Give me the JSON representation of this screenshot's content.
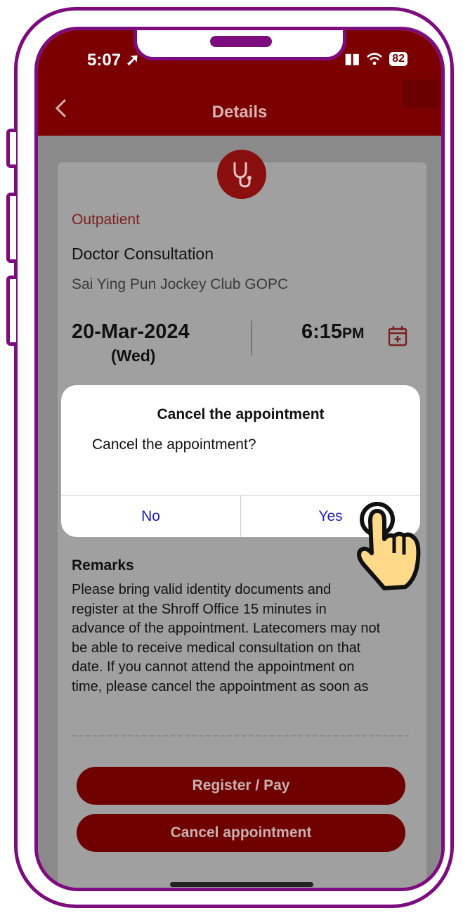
{
  "status": {
    "time": "5:07",
    "battery": "82"
  },
  "nav": {
    "title": "Details"
  },
  "appointment": {
    "type": "Outpatient",
    "service": "Doctor Consultation",
    "clinic": "Sai Ying Pun Jockey Club GOPC",
    "date": "20-Mar-2024",
    "weekday": "(Wed)",
    "time": "6:15",
    "time_period": "PM"
  },
  "remarks": {
    "heading": "Remarks",
    "text": "Please bring valid identity documents and register at the Shroff Office 15 minutes in advance of the appointment. Latecomers may not be able to receive medical consultation on that date. If you cannot attend the appointment on time, please cancel the appointment as soon as"
  },
  "actions": {
    "register_pay": "Register / Pay",
    "cancel": "Cancel appointment"
  },
  "dialog": {
    "title": "Cancel the appointment",
    "message": "Cancel the appointment?",
    "no": "No",
    "yes": "Yes"
  },
  "colors": {
    "brand": "#7b0000",
    "frame": "#7d0c7e",
    "dialog_button": "#1d1fb7",
    "hand": "#ffd98a"
  },
  "icons": [
    "back-chevron-icon",
    "stethoscope-icon",
    "calendar-add-icon",
    "signal-icon",
    "wifi-icon",
    "battery-icon",
    "location-arrow-icon",
    "pointing-hand-icon"
  ]
}
